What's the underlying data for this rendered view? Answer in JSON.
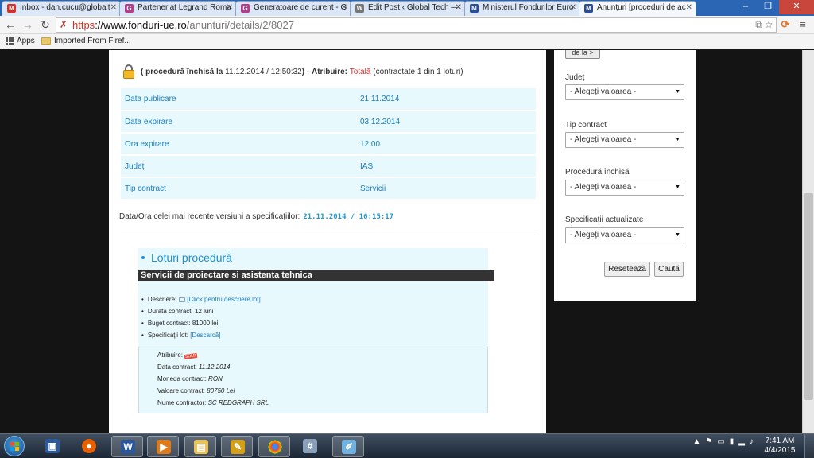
{
  "browser": {
    "tabs": [
      {
        "title": "Inbox - dan.cucu@globalt",
        "icon": "gmail-icon",
        "color": "#d93025"
      },
      {
        "title": "Parteneriat Legrand Roma",
        "icon": "site-icon",
        "color": "#b83a8c"
      },
      {
        "title": "Generatoare de curent - G",
        "icon": "site-icon",
        "color": "#b83a8c"
      },
      {
        "title": "Edit Post ‹ Global Tech —",
        "icon": "wordpress-icon",
        "color": "#777777"
      },
      {
        "title": "Ministerul Fondurilor Euro",
        "icon": "site-icon",
        "color": "#2a4d9b"
      },
      {
        "title": "Anunțuri [proceduri de ac",
        "icon": "site-icon",
        "color": "#2a4d9b"
      }
    ],
    "url": {
      "protocol": "https",
      "host": "://www.fonduri-ue.ro",
      "path": "/anunturi/details/2/8027"
    },
    "bookmarks": [
      {
        "label": "Apps"
      },
      {
        "label": "Imported From Firef..."
      }
    ]
  },
  "page": {
    "status": {
      "prefix": "( procedură închisă la",
      "closed_at": "11.12.2014 / 12:50:32",
      "paren_close": ")",
      "dash": "-",
      "award_label": "Atribuire:",
      "award_value": "Totală",
      "award_detail": "(contractate 1 din 1 loturi)"
    },
    "details": [
      {
        "label": "Data publicare",
        "value": "21.11.2014"
      },
      {
        "label": "Data expirare",
        "value": "03.12.2014"
      },
      {
        "label": "Ora expirare",
        "value": "12:00"
      },
      {
        "label": "Județ",
        "value": "IASI"
      },
      {
        "label": "Tip contract",
        "value": "Servicii"
      }
    ],
    "spec_version": {
      "label": "Data/Ora celei mai recente versiuni a specificaţiilor:",
      "value": "21.11.2014 / 16:15:17"
    },
    "loturi": {
      "title": "Loturi procedură",
      "lot_name": "Servicii de proiectare si asistenta tehnica",
      "items": {
        "descriere_label": "Descriere:",
        "descriere_link": "[Click pentru descriere lot]",
        "durata": "Durată contract: 12 luni",
        "buget": "Buget contract: 81000 lei",
        "spec_label": "Specificaţii lot:",
        "spec_link": "[Descarcă]"
      },
      "award": {
        "atribuire_label": "Atribuire:",
        "stamp": "SOLD",
        "data_label": "Data contract:",
        "data_value": "11.12.2014",
        "moneda_label": "Moneda contract:",
        "moneda_value": "RON",
        "valoare_label": "Valoare contract:",
        "valoare_value": "80750 Lei",
        "contractor_label": "Nume contractor:",
        "contractor_value": "SC REDGRAPH SRL"
      }
    }
  },
  "sidebar": {
    "top_button": "de la >",
    "filters": [
      {
        "label": "Județ",
        "value": "- Alegeți valoarea -"
      },
      {
        "label": "Tip contract",
        "value": "- Alegeți valoarea -"
      },
      {
        "label": "Procedură închisă",
        "value": "- Alegeți valoarea -"
      },
      {
        "label": "Specificații actualizate",
        "value": "- Alegeți valoarea -"
      }
    ],
    "reset_label": "Resetează",
    "search_label": "Caută"
  },
  "taskbar": {
    "apps": [
      "save-app",
      "firefox-app",
      "word-app",
      "media-app",
      "explorer-app",
      "paint-app",
      "chrome-app",
      "calculator-app",
      "drawing-app"
    ],
    "time": "7:41 AM",
    "date": "4/4/2015"
  }
}
